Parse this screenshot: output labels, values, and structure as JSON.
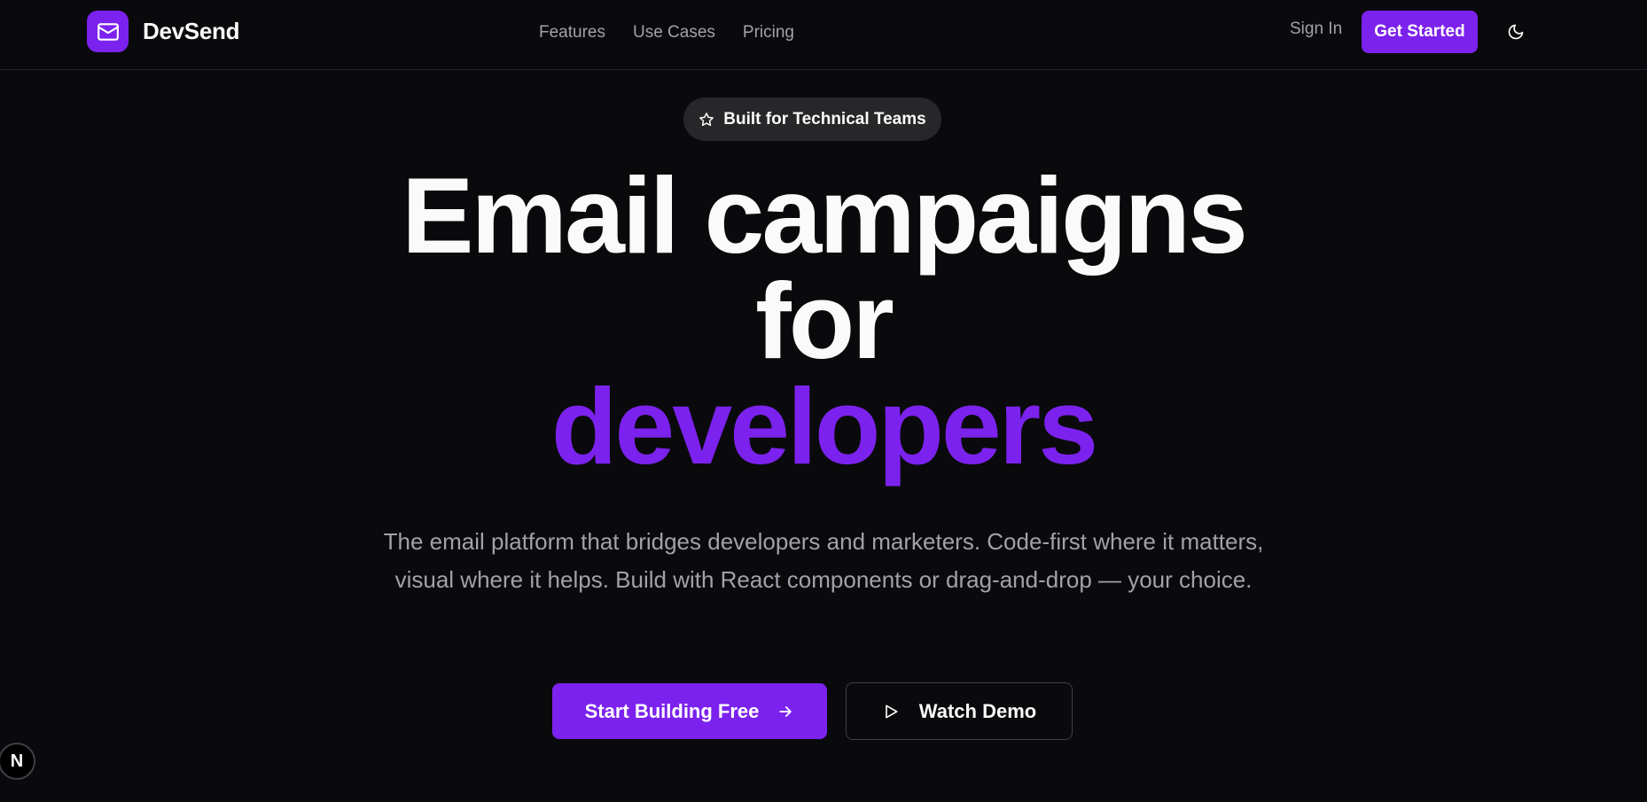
{
  "header": {
    "brand": "DevSend",
    "nav": [
      "Features",
      "Use Cases",
      "Pricing"
    ],
    "sign_in": "Sign In",
    "get_started": "Get Started"
  },
  "hero": {
    "badge": "Built for Technical Teams",
    "headline_line1": "Email campaigns",
    "headline_line2": "for",
    "headline_accent": "developers",
    "subtitle": "The email platform that bridges developers and marketers. Code-first where it matters, visual where it helps. Build with React components or drag-and-drop — your choice.",
    "cta_primary": "Start Building Free",
    "cta_secondary": "Watch Demo"
  },
  "dev_badge": "N",
  "icons": {
    "logo": "mail-icon",
    "theme": "moon-icon",
    "badge": "star-icon",
    "cta_primary": "arrow-right-icon",
    "cta_secondary": "play-icon"
  },
  "colors": {
    "background": "#0a0a0c",
    "accent": "#7c22ee",
    "muted_text": "#a1a1aa",
    "badge_bg": "#27272a"
  }
}
